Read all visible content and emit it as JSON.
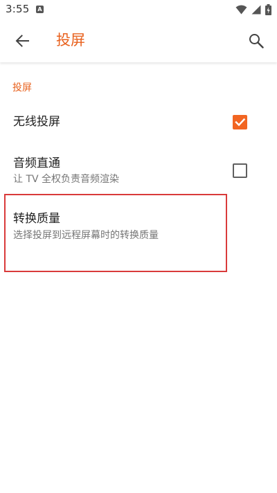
{
  "status_bar": {
    "time": "3:55",
    "notification_glyph": "A",
    "icons": [
      "wifi-icon",
      "signal-icon",
      "battery-charging-icon"
    ]
  },
  "app_bar": {
    "title": "投屏",
    "back_icon": "arrow-back-icon",
    "search_icon": "search-icon"
  },
  "section": {
    "header": "投屏"
  },
  "preferences": [
    {
      "title": "无线投屏",
      "summary": "",
      "checked": true
    },
    {
      "title": "音频直通",
      "summary": "让 TV 全权负责音频渲染",
      "checked": false
    },
    {
      "title": "转换质量",
      "summary": "选择投屏到远程屏幕时的转换质量"
    }
  ],
  "colors": {
    "accent": "#e8601c",
    "checkbox_checked": "#f26522",
    "highlight_border": "#d93a3a"
  }
}
